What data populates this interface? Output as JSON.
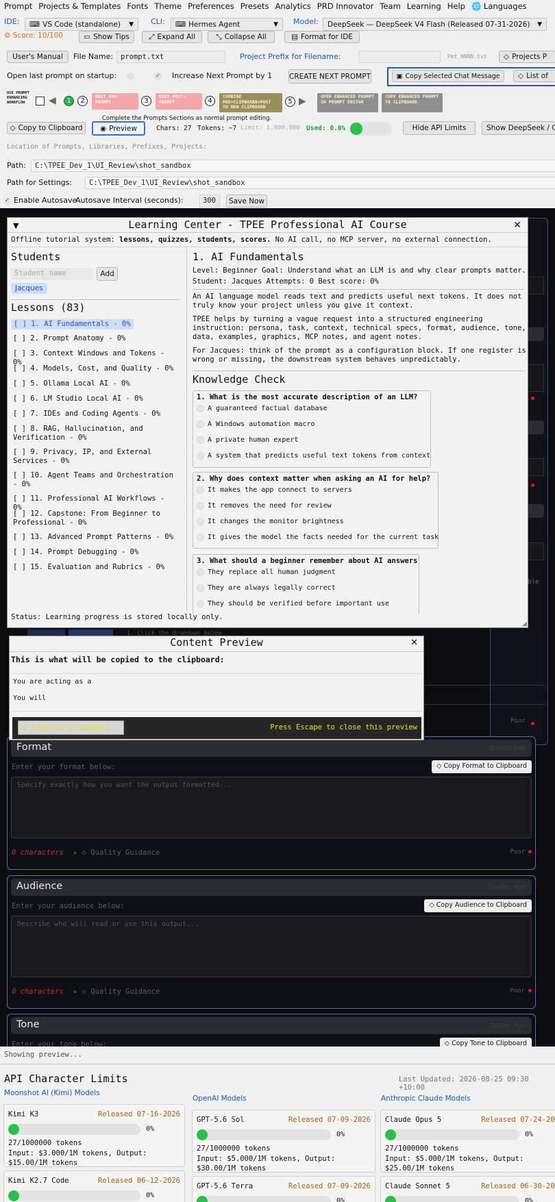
{
  "menu": [
    "Prompt",
    "Projects & Templates",
    "Fonts",
    "Theme",
    "Preferences",
    "Presets",
    "Analytics",
    "PRD Innovator",
    "Team",
    "Learning",
    "Help",
    "🌐 Languages"
  ],
  "toolbar1": {
    "ide_label": "IDE:",
    "ide_value": "VS Code (standalone)",
    "cli_label": "CLI:",
    "cli_value": "Hermes Agent",
    "model_label": "Model:",
    "model_value": "DeepSeek — DeepSeek V4 Flash (Released 07-31-2026)"
  },
  "toolbar2": {
    "score": "Score: 10/100",
    "show_tips": "Show Tips",
    "expand_all": "Expand All",
    "collapse_all": "Collapse All",
    "format_ide": "Format for IDE"
  },
  "toolbar3": {
    "users_manual": "User's Manual",
    "file_name_label": "File Name:",
    "file_name_value": "prompt.txt",
    "project_prefix_label": "Project Prefix for Filename:",
    "prefix_hint": "_Pmt_NNNN.txt",
    "projects_btn": "Projects P"
  },
  "toolbar4": {
    "open_last": "Open last prompt on startup:",
    "increase_next": "Increase Next Prompt by 1",
    "create_next": "CREATE NEXT PROMPT",
    "copy_selected": "Copy Selected Chat Message",
    "list_of": "List of"
  },
  "workflow": {
    "label": "USE PROMPT ENHANCING WORKFLOW",
    "steps": [
      "1",
      "2",
      "3",
      "4",
      "5"
    ],
    "edit_pre": "EDIT PRE-PROMPT",
    "edit_post": "EDIT POST-PROMPT",
    "combine": "COMBINE PRE+CLIPBOARD+POST TO NEW CLIPBOARD",
    "open_enhanced": "OPEN ENHANCED PROMPT IN PROMPT EDITOR",
    "copy_enhanced": "COPY ENHANCED PROMPT TO CLIPBOARD",
    "hint": "Complete the Prompts Sections as normal prompt editing."
  },
  "toolbar5": {
    "copy_clip": "Copy to Clipboard",
    "preview": "Preview",
    "chars": "Chars: 27",
    "tokens": "Tokens: ~7",
    "limit": "Limit: 1,000,000",
    "used": "Used: 0.0%",
    "hide_api": "Hide API Limits",
    "show_deepseek": "Show DeepSeek / C"
  },
  "paths": {
    "location_label": "Location of Prompts, Libraries, Prefixes, Projects:",
    "path_label": "Path:",
    "path_value": "C:\\TPEE_Dev_1\\UI_Review\\shot_sandbox",
    "settings_label": "Path for Settings:",
    "settings_value": "C:\\TPEE_Dev_1\\UI_Review\\shot_sandbox",
    "autosave_label": "Enable Autosave",
    "interval_label": "Autosave Interval (seconds):",
    "interval_value": "300",
    "save_now": "Save Now"
  },
  "learning": {
    "title": "Learning Center - TPEE Professional AI Course",
    "offline_prefix": "Offline tutorial system: ",
    "offline_bold": "lessons, quizzes, students, scores.",
    "offline_suffix": " No AI call, no MCP server, no external connection.",
    "students_title": "Students",
    "student_placeholder": "Student name",
    "add": "Add",
    "student": "Jacques",
    "lessons_title": "Lessons (83)",
    "lessons": [
      "[ ] 1. AI Fundamentals - 0%",
      "[ ] 2. Prompt Anatomy - 0%",
      "[ ] 3. Context Windows and Tokens - 0%",
      "[ ] 4. Models, Cost, and Quality - 0%",
      "[ ] 5. Ollama Local AI - 0%",
      "[ ] 6. LM Studio Local AI - 0%",
      "[ ] 7. IDEs and Coding Agents - 0%",
      "[ ] 8. RAG, Hallucination, and Verification - 0%",
      "[ ] 9. Privacy, IP, and External Services - 0%",
      "[ ] 10. Agent Teams and Orchestration - 0%",
      "[ ] 11. Professional AI Workflows - 0%",
      "[ ] 12. Capstone: From Beginner to Professional - 0%",
      "[ ] 13. Advanced Prompt Patterns - 0%",
      "[ ] 14. Prompt Debugging - 0%",
      "[ ] 15. Evaluation and Rubrics - 0%"
    ],
    "lesson_title": "1. AI Fundamentals",
    "meta1": "Level: Beginner   Goal: Understand what an LLM is and why clear prompts matter.",
    "meta2": "Student: Jacques   Attempts: 0   Best score: 0%",
    "para1": "An AI language model reads text and predicts useful next tokens. It does not truly know your project unless you give it context.",
    "para2": "TPEE helps by turning a vague request into a structured engineering instruction: persona, task, context, technical specs, format, audience, tone, data, examples, graphics, MCP notes, and agent notes.",
    "para3": "For Jacques: think of the prompt as a configuration block. If one register is wrong or missing, the downstream system behaves unpredictably.",
    "knowledge": "Knowledge Check",
    "questions": [
      {
        "q": "1. What is the most accurate description of an LLM?",
        "options": [
          "A guaranteed factual database",
          "A Windows automation macro",
          "A private human expert",
          "A system that predicts useful text tokens from context"
        ]
      },
      {
        "q": "2. Why does context matter when asking an AI for help?",
        "options": [
          "It makes the app connect to servers",
          "It removes the need for review",
          "It changes the monitor brightness",
          "It gives the model the facts needed for the current task"
        ]
      },
      {
        "q": "3. What should a beginner remember about AI answers?",
        "options": [
          "They replace all human judgment",
          "They are always legally correct",
          "They should be verified before important use"
        ]
      }
    ],
    "status": "Status: Learning progress is stored locally only."
  },
  "preview": {
    "title": "Content Preview",
    "subtitle": "This is what will be copied to the clipboard:",
    "line1": "You are acting as a",
    "line2": "You will",
    "copy_btn": "★ Copy to Clipboard",
    "escape": "Press Escape to close this preview"
  },
  "workspace": {
    "bg_snippet": "1. Click the dropdown below",
    "able": "able",
    "poor": "Poor",
    "sections": [
      {
        "title": "Format",
        "quality": "Quality: Poor",
        "enter": "Enter your format below:",
        "copy": "Copy Format to Clipboard",
        "placeholder": "Specify exactly how you want the output formatted...",
        "chars": "0 characters",
        "guidance": "Quality Guidance",
        "poor": "Poor"
      },
      {
        "title": "Audience",
        "quality": "Quality: Poor",
        "enter": "Enter your audience below:",
        "copy": "Copy Audience to Clipboard",
        "placeholder": "Describe who will read or use this output...",
        "chars": "0 characters",
        "guidance": "Quality Guidance",
        "poor": "Poor"
      },
      {
        "title": "Tone",
        "quality": "Quality: Poor",
        "enter": "Enter your tone below:",
        "copy": "Copy Tone to Clipboard"
      }
    ]
  },
  "status_bar": "Showing preview...",
  "api": {
    "title": "API Character Limits",
    "updated": "Last Updated: 2026-08-25 09:30 +10:00",
    "groups": [
      {
        "name": "Moonshot AI (Kimi) Models",
        "cards": [
          {
            "name": "Kimi K3",
            "released": "Released 07-16-2026",
            "usage": 0,
            "pct": "0%",
            "tokens": "27/1000000 tokens",
            "price": "Input: $3.000/1M tokens, Output: $15.00/1M tokens"
          },
          {
            "name": "Kimi K2.7 Code",
            "released": "Released 06-12-2026",
            "usage": 0,
            "pct": "0%"
          }
        ]
      },
      {
        "name": "OpenAI Models",
        "cards": [
          {
            "name": "GPT-5.6 Sol",
            "released": "Released 07-09-2026",
            "usage": 0,
            "pct": "0%",
            "tokens": "27/1000000 tokens",
            "price": "Input: $5.000/1M tokens, Output: $30.00/1M tokens"
          },
          {
            "name": "GPT-5.6 Terra",
            "released": "Released 07-09-2026",
            "usage": 0,
            "pct": "0%"
          }
        ]
      },
      {
        "name": "Anthropic Claude Models",
        "cards": [
          {
            "name": "Claude Opus 5",
            "released": "Released 07-24-202",
            "usage": 0,
            "pct": "0%",
            "tokens": "27/1000000 tokens",
            "price": "Input: $5.000/1M tokens, Output: $25.00/1M tokens"
          },
          {
            "name": "Claude Sonnet 5",
            "released": "Released 06-30-202",
            "usage": 0,
            "pct": "0%"
          }
        ]
      }
    ]
  },
  "colors": {
    "accent_blue": "#1f55c8",
    "score_orange": "#e0701a",
    "green": "#27c04a",
    "release_gold": "#a2670a",
    "pink_pill": "#f4a7a7",
    "olive_pill": "#9a8e62",
    "gray_pill": "#8e8e8e"
  }
}
